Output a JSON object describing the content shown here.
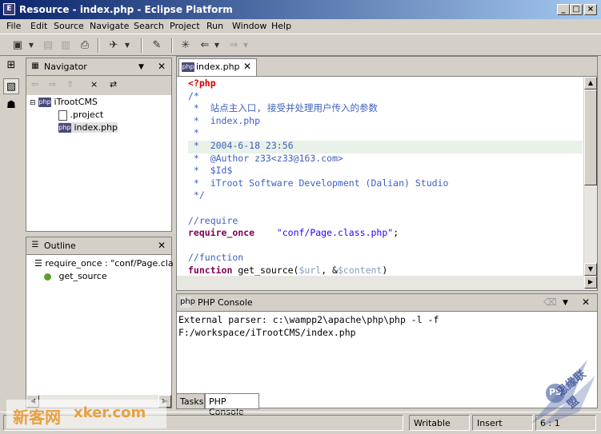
{
  "window": {
    "title": "Resource - index.php - Eclipse Platform",
    "minimize": "_",
    "maximize": "□",
    "close": "×"
  },
  "menu": [
    "File",
    "Edit",
    "Source",
    "Navigate",
    "Search",
    "Project",
    "Run",
    "Window",
    "Help"
  ],
  "navigator": {
    "title": "Navigator",
    "project": "iTrootCMS",
    "files": [
      ".project",
      "index.php"
    ]
  },
  "outline": {
    "title": "Outline",
    "items": [
      "require_once : \"conf/Page.cla",
      "get_source"
    ]
  },
  "editor": {
    "tab_label": "index.php",
    "tab_icon": "php",
    "lines": [
      {
        "text": "<?php",
        "cls": "tag"
      },
      {
        "text": "/*",
        "cls": "cm"
      },
      {
        "text": " *  站点主入口, 接受并处理用户传入的参数",
        "cls": "cm"
      },
      {
        "text": " *  index.php",
        "cls": "cm"
      },
      {
        "text": " *",
        "cls": "cm"
      },
      {
        "text": " *  2004-6-18 23:56",
        "cls": "cm"
      },
      {
        "text": " *  @Author z33<z33@163.com>",
        "cls": "cm"
      },
      {
        "text": " *  $Id$",
        "cls": "cm"
      },
      {
        "text": " *  iTroot Software Development (Dalian) Studio",
        "cls": "cm"
      },
      {
        "text": " */",
        "cls": "cm"
      },
      {
        "text": "",
        "cls": ""
      },
      {
        "text": "//require",
        "cls": "cm"
      },
      {
        "text": "",
        "cls": "req"
      },
      {
        "text": "",
        "cls": ""
      },
      {
        "text": "//function",
        "cls": "cm"
      },
      {
        "text": "",
        "cls": "fn"
      }
    ],
    "require_kw": "require_once",
    "require_str": "\"conf/Page.class.php\"",
    "require_end": ";",
    "fn_kw": "function",
    "fn_rest": " get_source(",
    "fn_var1": "$url",
    "fn_mid": ", &",
    "fn_var2": "$content",
    "fn_end": ")"
  },
  "console": {
    "title": "PHP Console",
    "lines": [
      "External parser: c:\\wampp2\\apache\\php\\php -l -f",
      "F:/workspace/iTrootCMS/index.php"
    ]
  },
  "bottom_tabs": [
    "Tasks",
    "PHP Console"
  ],
  "status": {
    "writable": "Writable",
    "mode": "Insert",
    "position": "6 : 1"
  },
  "watermark": {
    "left_cn": "新客网",
    "left_en": "xker.com",
    "right": "PS",
    "right_cn": "思缘联盟"
  },
  "colors": {
    "title_start": "#0a246a",
    "title_end": "#a6caf0",
    "comment": "#3f5fbf",
    "keyword": "#7f0055",
    "string": "#2a00ff"
  }
}
